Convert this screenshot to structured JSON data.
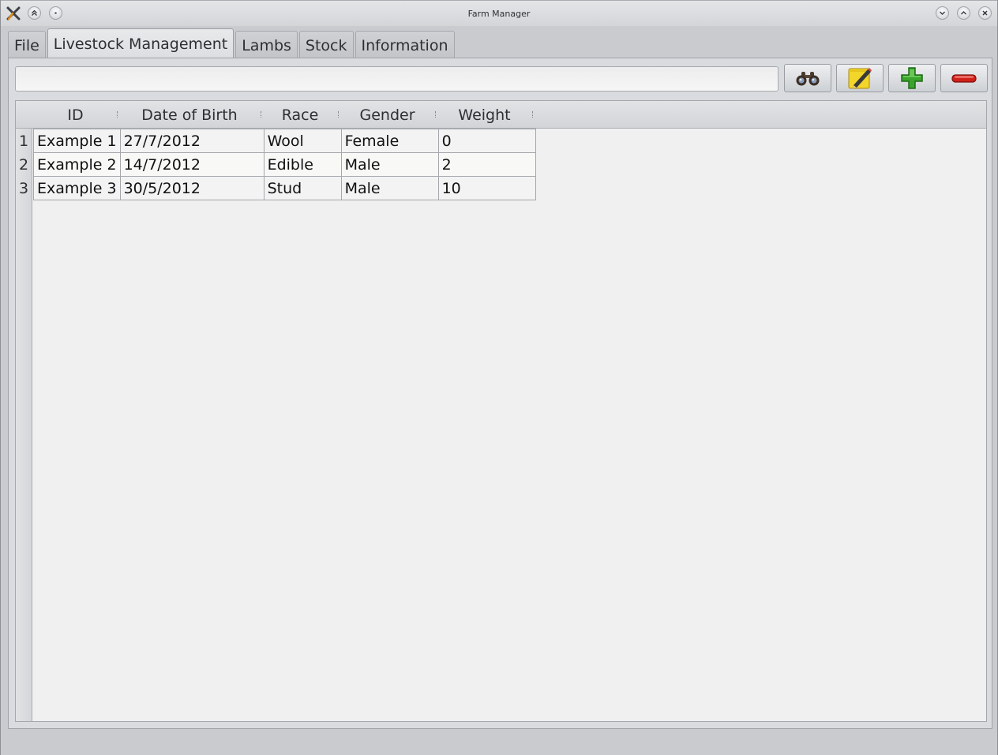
{
  "window": {
    "title": "Farm Manager"
  },
  "tabs": [
    {
      "label": "File"
    },
    {
      "label": "Livestock Management"
    },
    {
      "label": "Lambs"
    },
    {
      "label": "Stock"
    },
    {
      "label": "Information"
    }
  ],
  "active_tab": "Livestock Management",
  "search": {
    "value": "",
    "placeholder": ""
  },
  "toolbar": {
    "buttons": [
      {
        "icon": "binoculars-icon",
        "action": "search"
      },
      {
        "icon": "pencil-notepad-icon",
        "action": "edit"
      },
      {
        "icon": "green-plus-icon",
        "action": "add"
      },
      {
        "icon": "red-minus-icon",
        "action": "remove"
      }
    ]
  },
  "table": {
    "columns": [
      "ID",
      "Date of Birth",
      "Race",
      "Gender",
      "Weight"
    ],
    "row_numbers": [
      "1",
      "2",
      "3"
    ],
    "rows": [
      [
        "Example 1",
        "27/7/2012",
        "Wool",
        "Female",
        "0"
      ],
      [
        "Example 2",
        "14/7/2012",
        "Edible",
        "Male",
        "2"
      ],
      [
        "Example 3",
        "30/5/2012",
        "Stud",
        "Male",
        "10"
      ]
    ]
  },
  "colors": {
    "accent_green": "#3aa52c",
    "accent_red": "#d0201a",
    "note_yellow": "#f2d62a"
  }
}
